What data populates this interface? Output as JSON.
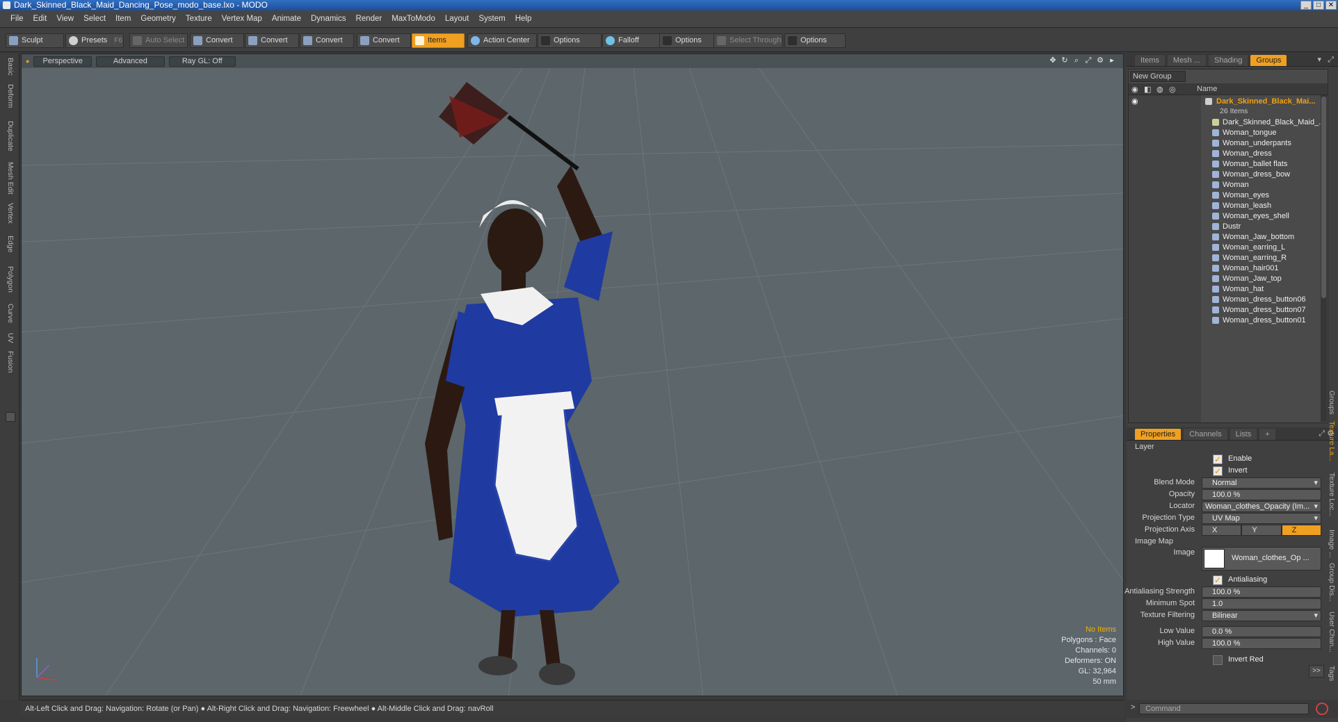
{
  "window": {
    "title": "Dark_Skinned_Black_Maid_Dancing_Pose_modo_base.lxo - MODO",
    "buttons": [
      "_",
      "□",
      "✕"
    ]
  },
  "menu": [
    "File",
    "Edit",
    "View",
    "Select",
    "Item",
    "Geometry",
    "Texture",
    "Vertex Map",
    "Animate",
    "Dynamics",
    "Render",
    "MaxToModo",
    "Layout",
    "System",
    "Help"
  ],
  "toolbar": {
    "sculpt": "Sculpt",
    "presets": "Presets",
    "presets_key": "F6",
    "auto_select": "Auto Select",
    "convert1": "Convert",
    "convert2": "Convert",
    "convert3": "Convert",
    "convert4": "Convert",
    "items": "Items",
    "action_center": "Action Center",
    "options1": "Options",
    "falloff": "Falloff",
    "options2": "Options",
    "select_through": "Select Through",
    "options3": "Options"
  },
  "left_tabs": [
    "Basic",
    "Deform",
    "Duplicate",
    "Mesh Edit",
    "Vertex",
    "Edge",
    "Polygon",
    "Curve",
    "UV",
    "Fusion"
  ],
  "viewport": {
    "view_mode": "Perspective",
    "shading": "Advanced",
    "raygl": "Ray GL: Off",
    "stats": {
      "items": "No Items",
      "polygons": "Polygons : Face",
      "channels": "Channels: 0",
      "deformers": "Deformers: ON",
      "gl": "GL: 32,964",
      "scale": "50 mm"
    }
  },
  "status_bar": "Alt-Left Click and Drag: Navigation: Rotate (or Pan) ● Alt-Right Click and Drag: Navigation: Freewheel ● Alt-Middle Click and Drag: navRoll",
  "panel_tabs": {
    "top": [
      "Items",
      "Mesh ...",
      "Shading",
      "Groups"
    ],
    "bottom": [
      "Properties",
      "Channels",
      "Lists",
      "+"
    ]
  },
  "groups": {
    "new_group": "New Group",
    "name_header": "Name",
    "group_name": "Dark_Skinned_Black_Mai...",
    "group_count": "26 Items",
    "items": [
      "Dark_Skinned_Black_Maid_...",
      "Woman_tongue",
      "Woman_underpants",
      "Woman_dress",
      "Woman_ballet flats",
      "Woman_dress_bow",
      "Woman",
      "Woman_eyes",
      "Woman_leash",
      "Woman_eyes_shell",
      "Dustr",
      "Woman_Jaw_bottom",
      "Woman_earring_L",
      "Woman_earring_R",
      "Woman_hair001",
      "Woman_Jaw_top",
      "Woman_hat",
      "Woman_dress_button06",
      "Woman_dress_button07",
      "Woman_dress_button01"
    ]
  },
  "properties": {
    "layer_section": "Layer",
    "enable": "Enable",
    "invert": "Invert",
    "blend_mode_label": "Blend Mode",
    "blend_mode": "Normal",
    "opacity_label": "Opacity",
    "opacity": "100.0 %",
    "locator_label": "Locator",
    "locator": "Woman_clothes_Opacity (Im...",
    "projection_type_label": "Projection Type",
    "projection_type": "UV Map",
    "projection_axis_label": "Projection Axis",
    "axes": [
      "X",
      "Y",
      "Z"
    ],
    "image_map_section": "Image Map",
    "image_label": "Image",
    "image": "Woman_clothes_Op ...",
    "antialiasing": "Antialiasing",
    "aa_strength_label": "Antialiasing Strength",
    "aa_strength": "100.0 %",
    "min_spot_label": "Minimum Spot",
    "min_spot": "1.0",
    "tex_filter_label": "Texture Filtering",
    "tex_filter": "Bilinear",
    "low_value_label": "Low Value",
    "low_value": "0.0 %",
    "high_value_label": "High Value",
    "high_value": "100.0 %",
    "invert_red": "Invert Red",
    "more": ">>"
  },
  "right_tabs": [
    "Groups",
    "Texture La...",
    "Texture Loc...",
    "Image ...",
    "Group Dis...",
    "User Chan...",
    "Tags"
  ],
  "command": {
    "prompt": ">",
    "placeholder": "Command"
  }
}
